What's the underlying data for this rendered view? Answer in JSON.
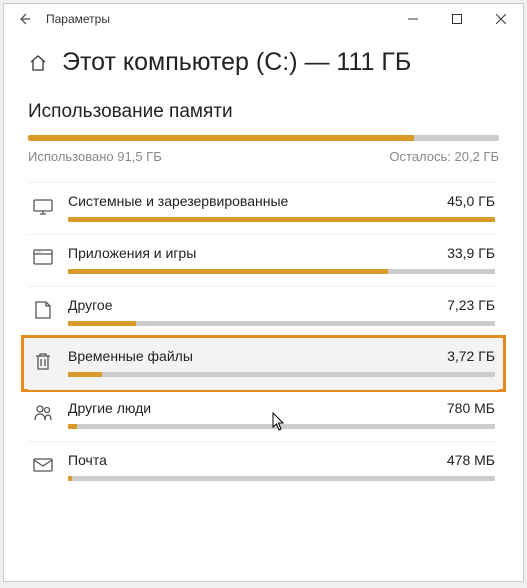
{
  "window": {
    "title": "Параметры"
  },
  "page": {
    "title": "Этот компьютер (C:) — 111 ГБ"
  },
  "section_title": "Использование памяти",
  "total": {
    "used_label": "Использовано 91,5 ГБ",
    "remaining_label": "Осталось: 20,2 ГБ",
    "percent": 82
  },
  "categories": [
    {
      "icon": "system",
      "name": "Системные и зарезервированные",
      "size": "45,0 ГБ",
      "percent": 100,
      "highlighted": false
    },
    {
      "icon": "apps",
      "name": "Приложения и игры",
      "size": "33,9 ГБ",
      "percent": 75,
      "highlighted": false
    },
    {
      "icon": "other",
      "name": "Другое",
      "size": "7,23 ГБ",
      "percent": 16,
      "highlighted": false
    },
    {
      "icon": "temp",
      "name": "Временные файлы",
      "size": "3,72 ГБ",
      "percent": 8,
      "highlighted": true
    },
    {
      "icon": "people",
      "name": "Другие люди",
      "size": "780 МБ",
      "percent": 2,
      "highlighted": false
    },
    {
      "icon": "mail",
      "name": "Почта",
      "size": "478 МБ",
      "percent": 1,
      "highlighted": false
    }
  ]
}
